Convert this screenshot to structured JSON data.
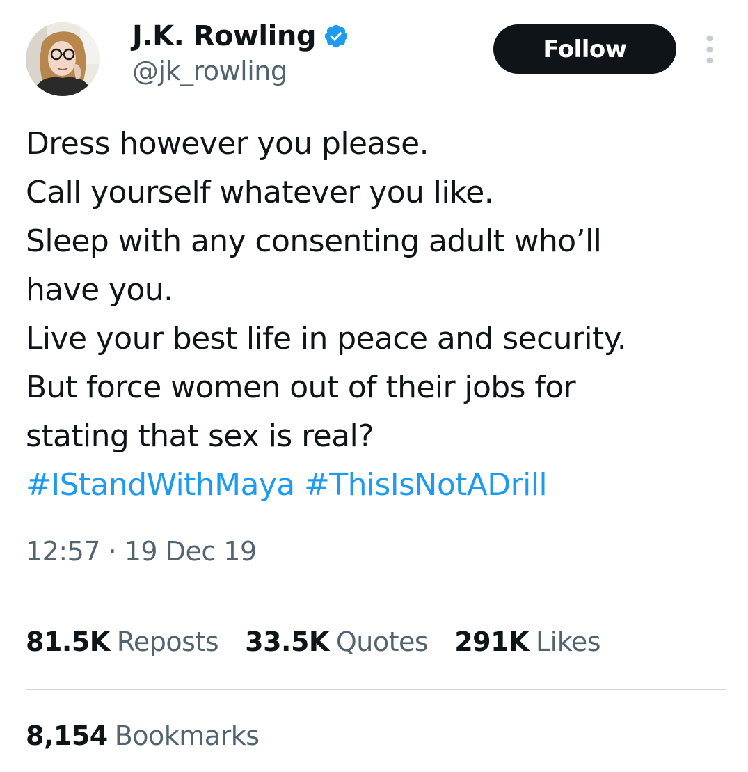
{
  "author": {
    "display_name": "J.K. Rowling",
    "handle": "@jk_rowling",
    "verified": true
  },
  "follow_button": {
    "label": "Follow"
  },
  "tweet": {
    "lines": [
      "Dress however you please.",
      "Call yourself whatever you like.",
      "Sleep with any consenting adult who’ll",
      "have you.",
      "Live your best life in peace and security.",
      "But force women out of their jobs for",
      "stating that sex is real?"
    ],
    "hashtags": [
      "#IStandWithMaya",
      "#ThisIsNotADrill"
    ]
  },
  "timestamp": "12:57 · 19 Dec 19",
  "stats": {
    "reposts": {
      "value": "81.5K",
      "label": "Reposts"
    },
    "quotes": {
      "value": "33.5K",
      "label": "Quotes"
    },
    "likes": {
      "value": "291K",
      "label": "Likes"
    }
  },
  "bookmarks": {
    "value": "8,154",
    "label": "Bookmarks"
  },
  "colors": {
    "text_primary": "#0f1419",
    "text_secondary": "#536471",
    "link": "#1d9bf0",
    "verified_badge": "#1d9bf0",
    "follow_button_bg": "#0f1419",
    "divider": "#cfd9de"
  },
  "icons": {
    "verified": "verified-badge-icon",
    "more": "more-options-icon"
  }
}
